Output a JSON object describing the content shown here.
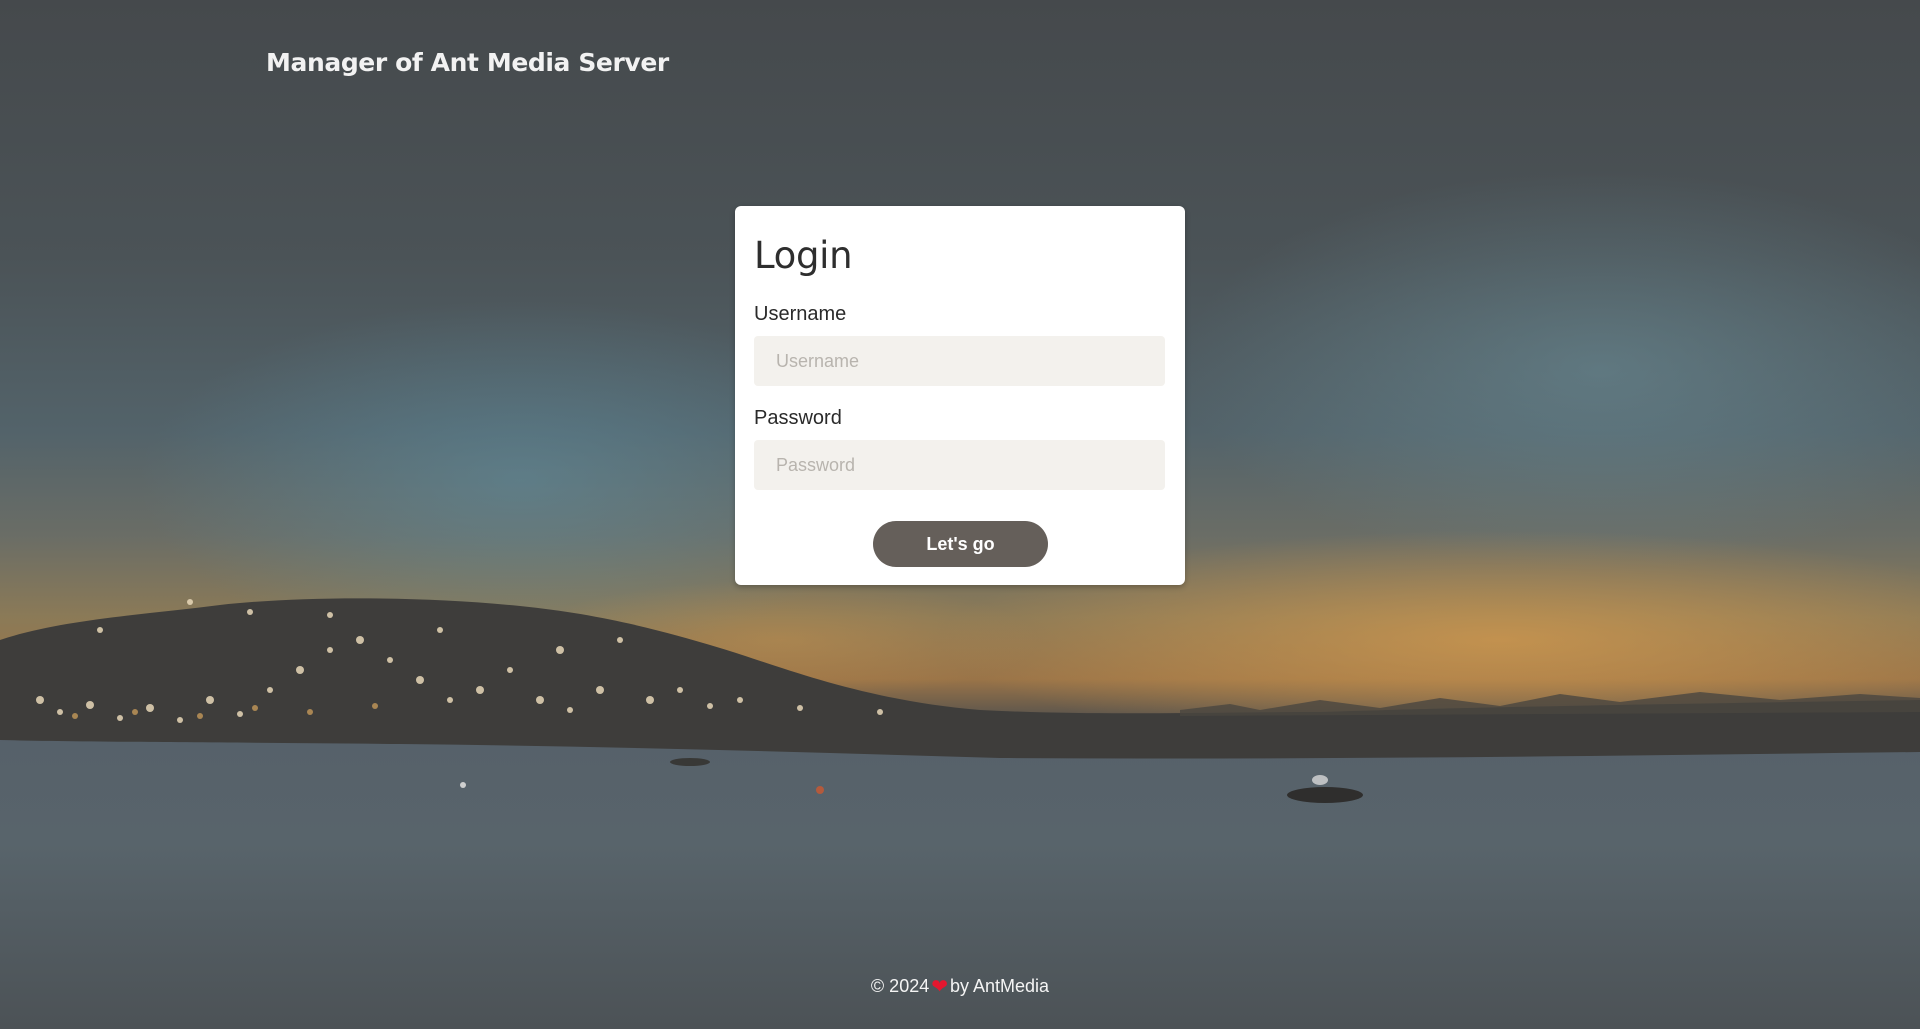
{
  "app": {
    "brand_title": "Manager of Ant Media Server"
  },
  "login": {
    "title": "Login",
    "username_label": "Username",
    "username_placeholder": "Username",
    "username_value": "",
    "password_label": "Password",
    "password_placeholder": "Password",
    "password_value": "",
    "submit_label": "Let's go"
  },
  "footer": {
    "copyright": "© 2024",
    "heart_icon": "heart-icon",
    "by_text": "by AntMedia"
  },
  "colors": {
    "button": "#655f5a",
    "input_bg": "#f3f1ed",
    "heart": "#e3172f",
    "card_bg": "#ffffff"
  }
}
